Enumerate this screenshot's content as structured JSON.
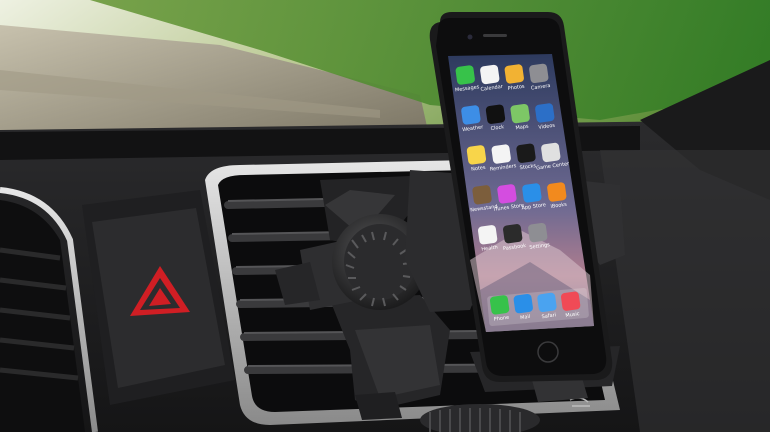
{
  "scene": {
    "subject": "smartphone in car air vent mount",
    "colors": {
      "sky": "#d9e2c4",
      "grass": "#4a8a2a",
      "dashboard": "#202022",
      "mount": "#2a2a2c",
      "hazard_red": "#d01e24",
      "wallpaper_top": "#3a4a6e",
      "wallpaper_bottom": "#a8748a"
    }
  },
  "phone": {
    "home_icons": [
      {
        "name": "messages-icon",
        "label": "Messages",
        "color": "#37c24a"
      },
      {
        "name": "calendar-icon",
        "label": "Calendar",
        "color": "#f4f4f4"
      },
      {
        "name": "photos-icon",
        "label": "Photos",
        "color": "#f2b233"
      },
      {
        "name": "camera-icon",
        "label": "Camera",
        "color": "#8e8e93"
      },
      {
        "name": "weather-icon",
        "label": "Weather",
        "color": "#3d8ee6"
      },
      {
        "name": "clock-icon",
        "label": "Clock",
        "color": "#111111"
      },
      {
        "name": "maps-icon",
        "label": "Maps",
        "color": "#7dc766"
      },
      {
        "name": "videos-icon",
        "label": "Videos",
        "color": "#2c6fc7"
      },
      {
        "name": "notes-icon",
        "label": "Notes",
        "color": "#f8d54a"
      },
      {
        "name": "reminders-icon",
        "label": "Reminders",
        "color": "#f4f4f4"
      },
      {
        "name": "stocks-icon",
        "label": "Stocks",
        "color": "#1a1a1a"
      },
      {
        "name": "game-center-icon",
        "label": "Game Center",
        "color": "#e0e0e0"
      },
      {
        "name": "newsstand-icon",
        "label": "Newsstand",
        "color": "#7c5e3c"
      },
      {
        "name": "itunes-store-icon",
        "label": "iTunes Store",
        "color": "#d44de0"
      },
      {
        "name": "app-store-icon",
        "label": "App Store",
        "color": "#2a8fe8"
      },
      {
        "name": "ibooks-icon",
        "label": "iBooks",
        "color": "#f28a1e"
      },
      {
        "name": "health-icon",
        "label": "Health",
        "color": "#f4f4f4"
      },
      {
        "name": "passbook-icon",
        "label": "Passbook",
        "color": "#2b2b2b"
      },
      {
        "name": "settings-icon",
        "label": "Settings",
        "color": "#8e8e93"
      }
    ],
    "dock_icons": [
      {
        "name": "phone-icon",
        "label": "Phone",
        "color": "#37c24a"
      },
      {
        "name": "mail-icon",
        "label": "Mail",
        "color": "#2a8fe8"
      },
      {
        "name": "safari-icon",
        "label": "Safari",
        "color": "#4aa3f0"
      },
      {
        "name": "music-icon",
        "label": "Music",
        "color": "#f04a56"
      }
    ]
  }
}
